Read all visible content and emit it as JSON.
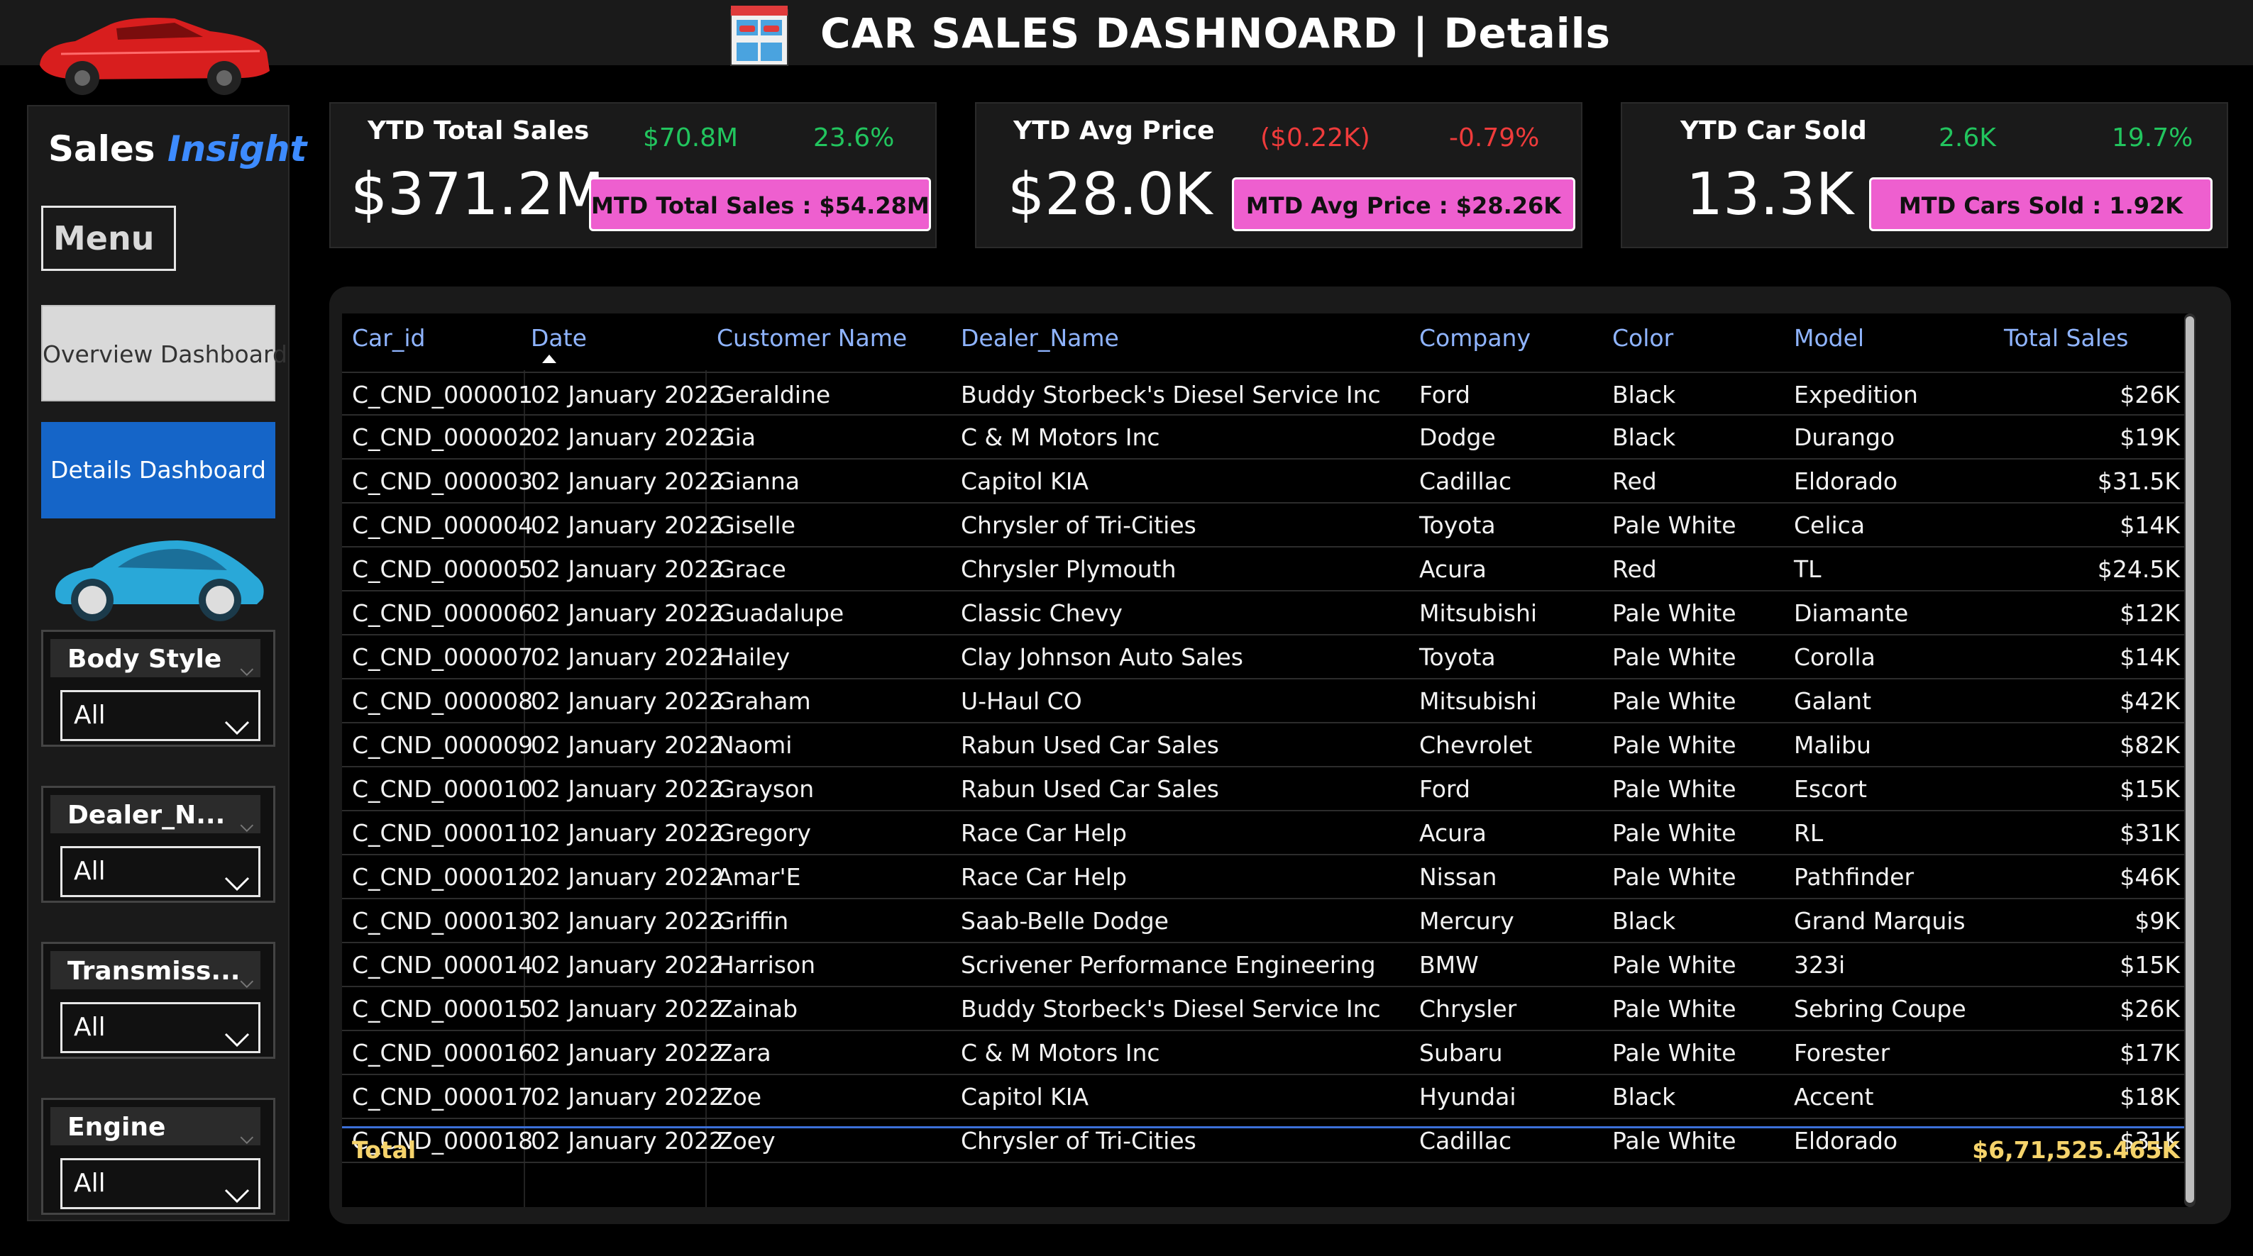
{
  "header": {
    "title": "CAR SALES DASHNOARD | Details"
  },
  "sidebar": {
    "brand_left": "Sales",
    "brand_right": "Insight",
    "menu_label": "Menu",
    "nav": {
      "overview": "Overview Dashboard",
      "details": "Details Dashboard"
    },
    "filters": [
      {
        "label": "Body Style",
        "value": "All"
      },
      {
        "label": "Dealer_N...",
        "value": "All"
      },
      {
        "label": "Transmiss...",
        "value": "All"
      },
      {
        "label": "Engine",
        "value": "All"
      }
    ]
  },
  "kpis": {
    "sales": {
      "label": "YTD Total Sales",
      "value": "$371.2M",
      "delta_value": "$70.8M",
      "delta_pct": "23.6%",
      "mtd": "MTD Total Sales : $54.28M",
      "trend": "positive"
    },
    "price": {
      "label": "YTD Avg Price",
      "value": "$28.0K",
      "delta_value": "($0.22K)",
      "delta_pct": "-0.79%",
      "mtd": "MTD Avg Price : $28.26K",
      "trend": "negative"
    },
    "sold": {
      "label": "YTD Car Sold",
      "value": "13.3K",
      "delta_value": "2.6K",
      "delta_pct": "19.7%",
      "mtd": "MTD Cars Sold : 1.92K",
      "trend": "positive"
    }
  },
  "table": {
    "columns": [
      "Car_id",
      "Date",
      "Customer Name",
      "Dealer_Name",
      "Company",
      "Color",
      "Model",
      "Total Sales"
    ],
    "sorted_column": "Date",
    "rows": [
      [
        "C_CND_000001",
        "02 January 2022",
        "Geraldine",
        "Buddy Storbeck's Diesel Service Inc",
        "Ford",
        "Black",
        "Expedition",
        "$26K"
      ],
      [
        "C_CND_000002",
        "02 January 2022",
        "Gia",
        "C & M Motors Inc",
        "Dodge",
        "Black",
        "Durango",
        "$19K"
      ],
      [
        "C_CND_000003",
        "02 January 2022",
        "Gianna",
        "Capitol KIA",
        "Cadillac",
        "Red",
        "Eldorado",
        "$31.5K"
      ],
      [
        "C_CND_000004",
        "02 January 2022",
        "Giselle",
        "Chrysler of Tri-Cities",
        "Toyota",
        "Pale White",
        "Celica",
        "$14K"
      ],
      [
        "C_CND_000005",
        "02 January 2022",
        "Grace",
        "Chrysler Plymouth",
        "Acura",
        "Red",
        "TL",
        "$24.5K"
      ],
      [
        "C_CND_000006",
        "02 January 2022",
        "Guadalupe",
        "Classic Chevy",
        "Mitsubishi",
        "Pale White",
        "Diamante",
        "$12K"
      ],
      [
        "C_CND_000007",
        "02 January 2022",
        "Hailey",
        "Clay Johnson Auto Sales",
        "Toyota",
        "Pale White",
        "Corolla",
        "$14K"
      ],
      [
        "C_CND_000008",
        "02 January 2022",
        "Graham",
        "U-Haul CO",
        "Mitsubishi",
        "Pale White",
        "Galant",
        "$42K"
      ],
      [
        "C_CND_000009",
        "02 January 2022",
        "Naomi",
        "Rabun Used Car Sales",
        "Chevrolet",
        "Pale White",
        "Malibu",
        "$82K"
      ],
      [
        "C_CND_000010",
        "02 January 2022",
        "Grayson",
        "Rabun Used Car Sales",
        "Ford",
        "Pale White",
        "Escort",
        "$15K"
      ],
      [
        "C_CND_000011",
        "02 January 2022",
        "Gregory",
        "Race Car Help",
        "Acura",
        "Pale White",
        "RL",
        "$31K"
      ],
      [
        "C_CND_000012",
        "02 January 2022",
        "Amar'E",
        "Race Car Help",
        "Nissan",
        "Pale White",
        "Pathfinder",
        "$46K"
      ],
      [
        "C_CND_000013",
        "02 January 2022",
        "Griffin",
        "Saab-Belle Dodge",
        "Mercury",
        "Black",
        "Grand Marquis",
        "$9K"
      ],
      [
        "C_CND_000014",
        "02 January 2022",
        "Harrison",
        "Scrivener Performance Engineering",
        "BMW",
        "Pale White",
        "323i",
        "$15K"
      ],
      [
        "C_CND_000015",
        "02 January 2022",
        "Zainab",
        "Buddy Storbeck's Diesel Service Inc",
        "Chrysler",
        "Pale White",
        "Sebring Coupe",
        "$26K"
      ],
      [
        "C_CND_000016",
        "02 January 2022",
        "Zara",
        "C & M Motors Inc",
        "Subaru",
        "Pale White",
        "Forester",
        "$17K"
      ],
      [
        "C_CND_000017",
        "02 January 2022",
        "Zoe",
        "Capitol KIA",
        "Hyundai",
        "Black",
        "Accent",
        "$18K"
      ],
      [
        "C_CND_000018",
        "02 January 2022",
        "Zoey",
        "Chrysler of Tri-Cities",
        "Cadillac",
        "Pale White",
        "Eldorado",
        "$31K"
      ]
    ],
    "total_label": "Total",
    "total_value": "$6,71,525.465K"
  }
}
